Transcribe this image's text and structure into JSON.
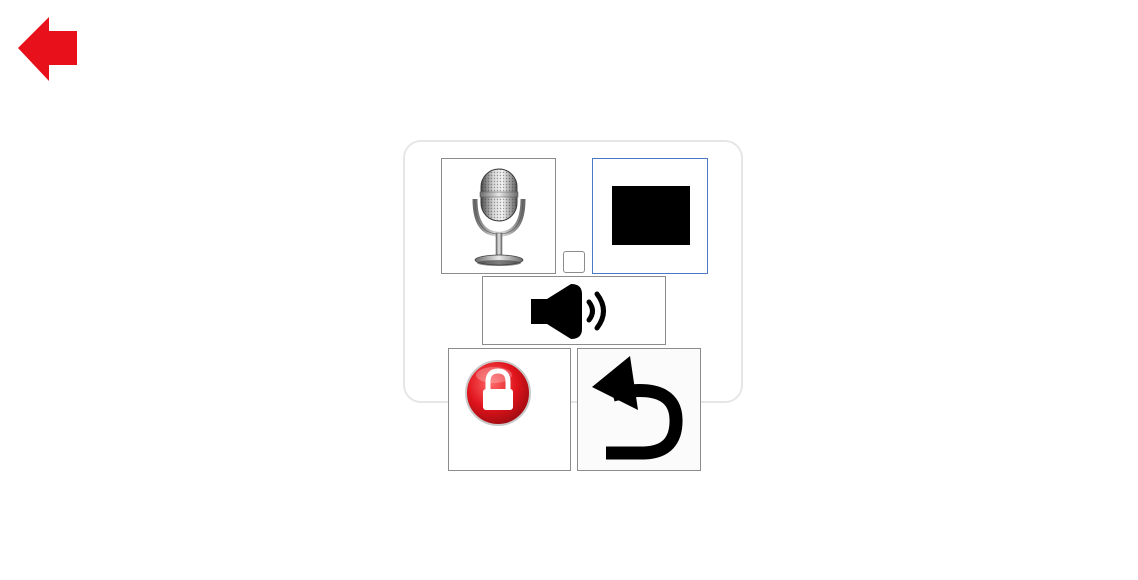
{
  "toolbar": {
    "back": {
      "icon": "red-left-arrow-icon",
      "color": "#e8101a"
    }
  },
  "panel": {
    "buttons": [
      {
        "name": "microphone-button",
        "icon": "microphone-icon"
      },
      {
        "name": "stop-button",
        "icon": "stop-square-icon",
        "selected": true
      },
      {
        "name": "option-checkbox",
        "checked": false
      },
      {
        "name": "speaker-button",
        "icon": "speaker-icon"
      },
      {
        "name": "lock-button",
        "icon": "red-lock-icon",
        "color": "#e0141c"
      },
      {
        "name": "undo-button",
        "icon": "undo-arrow-icon"
      }
    ]
  }
}
